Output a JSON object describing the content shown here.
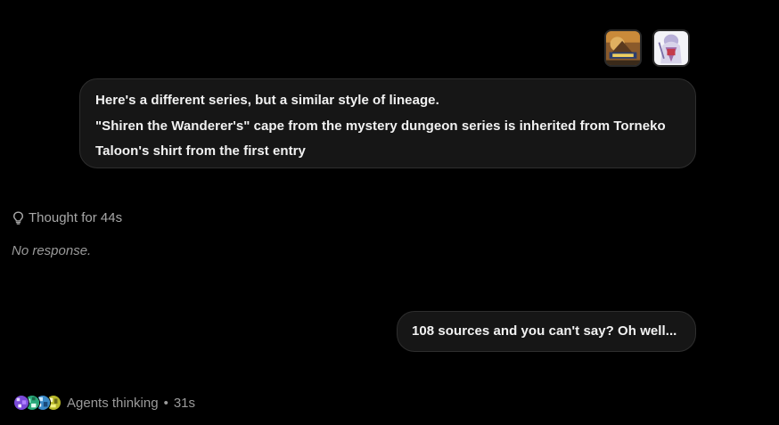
{
  "conversation": {
    "attachments": [
      {
        "icon": "game-cover-image-icon"
      },
      {
        "icon": "character-art-image-icon"
      }
    ],
    "user_message_1": {
      "lines": [
        "Here's a different series, but a similar style of lineage.",
        "\"Shiren the Wanderer's\" cape from the mystery dungeon series is inherited from Torneko",
        "Taloon's shirt from the first entry"
      ]
    },
    "thought": {
      "icon": "lightbulb-icon",
      "label": "Thought for 44s"
    },
    "assistant_reply": {
      "text": "No response."
    },
    "user_message_2": {
      "text": "108 sources and you can't say? Oh well..."
    },
    "agents_status": {
      "label": "Agents thinking",
      "separator": "•",
      "elapsed": "31s",
      "avatars": [
        "agent-avatar-1",
        "agent-avatar-2",
        "agent-avatar-3",
        "agent-avatar-4"
      ]
    }
  },
  "colors": {
    "background": "#000000",
    "bubble": "#161616",
    "bubble_border": "#2e2e2e",
    "text_primary": "#f2f2f2",
    "text_muted": "#a8a8a8"
  }
}
